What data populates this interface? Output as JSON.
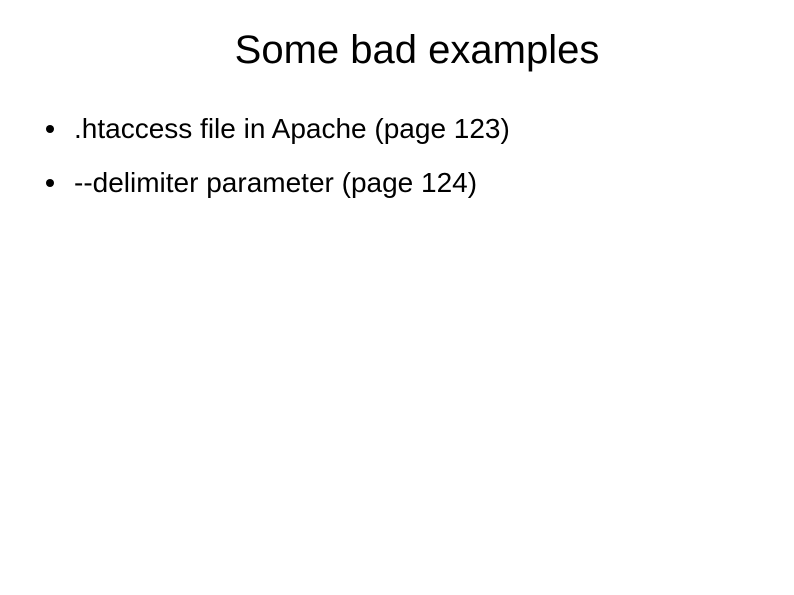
{
  "slide": {
    "title": "Some bad examples",
    "bullets": [
      ".htaccess file in Apache (page 123)",
      "--delimiter  parameter (page 124)"
    ]
  }
}
